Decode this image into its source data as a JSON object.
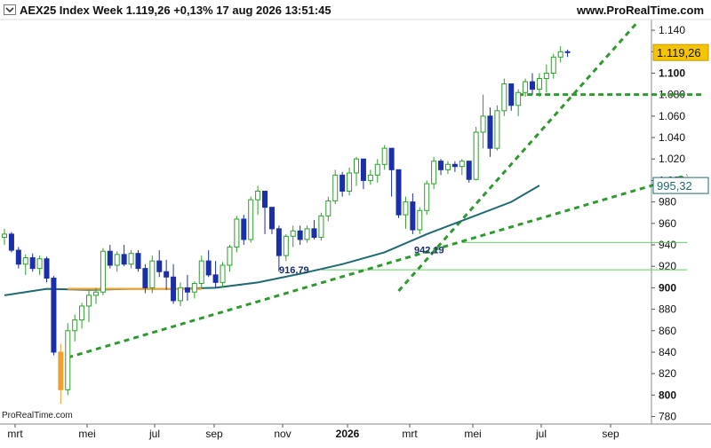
{
  "header": {
    "title": "AEX25 Index Week 1.119,26 +0,13% 17 aug 2026 13:51:45",
    "brand": "www.ProRealTime.com"
  },
  "watermark": "ProRealTime.com",
  "icons": {
    "settings": "chevron-down-icon"
  },
  "colors": {
    "up": "#2e9e2e",
    "down": "#1a2fa8",
    "ma": "#1f6a70",
    "trend": "#2e9a2e",
    "price_badge": "#f5c400",
    "ma_badge_border": "#1f6a70",
    "highlight": "#f0a030"
  },
  "chart_data": {
    "type": "candlestick",
    "title": "AEX25 Index Week",
    "x_labels": [
      "mrt",
      "mei",
      "jul",
      "sep",
      "nov",
      "2026",
      "mrt",
      "mei",
      "jul",
      "sep"
    ],
    "y_ticks": [
      "780",
      "800",
      "820",
      "840",
      "860",
      "880",
      "900",
      "920",
      "940",
      "960",
      "980",
      "1.000",
      "1.020",
      "1.040",
      "1.060",
      "1.080",
      "1.100",
      "1.120",
      "1.140"
    ],
    "y_tick_values": [
      780,
      800,
      820,
      840,
      860,
      880,
      900,
      920,
      940,
      960,
      980,
      1000,
      1020,
      1040,
      1060,
      1080,
      1100,
      1120,
      1140
    ],
    "bold_ticks": [
      800,
      900,
      1100
    ],
    "ylim": [
      773,
      1150
    ],
    "candles": [
      [
        947,
        955,
        940,
        950
      ],
      [
        950,
        952,
        933,
        935
      ],
      [
        935,
        938,
        918,
        922
      ],
      [
        922,
        931,
        912,
        928
      ],
      [
        928,
        932,
        915,
        918
      ],
      [
        918,
        930,
        912,
        927
      ],
      [
        927,
        929,
        905,
        909
      ],
      [
        909,
        911,
        837,
        840
      ],
      [
        840,
        848,
        792,
        805
      ],
      [
        805,
        867,
        800,
        860
      ],
      [
        860,
        875,
        850,
        870
      ],
      [
        870,
        886,
        862,
        883
      ],
      [
        883,
        897,
        868,
        893
      ],
      [
        893,
        900,
        885,
        896
      ],
      [
        896,
        937,
        893,
        934
      ],
      [
        934,
        940,
        918,
        921
      ],
      [
        921,
        934,
        915,
        931
      ],
      [
        931,
        940,
        920,
        922
      ],
      [
        922,
        935,
        918,
        932
      ],
      [
        932,
        935,
        915,
        918
      ],
      [
        918,
        922,
        895,
        900
      ],
      [
        900,
        930,
        895,
        925
      ],
      [
        925,
        935,
        910,
        915
      ],
      [
        915,
        926,
        898,
        910
      ],
      [
        910,
        922,
        885,
        888
      ],
      [
        888,
        905,
        883,
        900
      ],
      [
        900,
        912,
        888,
        896
      ],
      [
        896,
        906,
        890,
        904
      ],
      [
        904,
        930,
        900,
        925
      ],
      [
        925,
        935,
        910,
        912
      ],
      [
        912,
        925,
        900,
        905
      ],
      [
        905,
        924,
        900,
        921
      ],
      [
        921,
        940,
        915,
        938
      ],
      [
        938,
        967,
        933,
        964
      ],
      [
        964,
        968,
        940,
        945
      ],
      [
        945,
        985,
        942,
        982
      ],
      [
        982,
        995,
        968,
        990
      ],
      [
        990,
        978,
        950,
        975
      ],
      [
        975,
        973,
        950,
        955
      ],
      [
        955,
        958,
        915,
        930
      ],
      [
        930,
        950,
        925,
        948
      ],
      [
        948,
        958,
        938,
        953
      ],
      [
        953,
        958,
        940,
        945
      ],
      [
        945,
        958,
        942,
        955
      ],
      [
        955,
        963,
        945,
        947
      ],
      [
        947,
        970,
        944,
        967
      ],
      [
        967,
        985,
        962,
        981
      ],
      [
        981,
        1010,
        978,
        1005
      ],
      [
        1005,
        1008,
        985,
        990
      ],
      [
        990,
        1012,
        986,
        1007
      ],
      [
        1007,
        1022,
        995,
        1020
      ],
      [
        1020,
        1003,
        992,
        1000
      ],
      [
        1000,
        1010,
        996,
        1005
      ],
      [
        1005,
        1020,
        998,
        1015
      ],
      [
        1015,
        1033,
        1010,
        1030
      ],
      [
        1030,
        1030,
        985,
        1010
      ],
      [
        1010,
        1000,
        965,
        968
      ],
      [
        968,
        985,
        955,
        980
      ],
      [
        980,
        988,
        950,
        954
      ],
      [
        954,
        975,
        950,
        972
      ],
      [
        972,
        1000,
        968,
        997
      ],
      [
        997,
        1022,
        992,
        1018
      ],
      [
        1018,
        1020,
        1005,
        1010
      ],
      [
        1010,
        1018,
        1006,
        1015
      ],
      [
        1015,
        1018,
        1008,
        1013
      ],
      [
        1013,
        1020,
        1005,
        1018
      ],
      [
        1018,
        1010,
        998,
        1001
      ],
      [
        1001,
        1050,
        1000,
        1045
      ],
      [
        1045,
        1080,
        1030,
        1060
      ],
      [
        1060,
        1068,
        1022,
        1030
      ],
      [
        1030,
        1070,
        1028,
        1065
      ],
      [
        1065,
        1095,
        1060,
        1090
      ],
      [
        1090,
        1088,
        1065,
        1070
      ],
      [
        1070,
        1085,
        1060,
        1082
      ],
      [
        1082,
        1095,
        1078,
        1092
      ],
      [
        1092,
        1100,
        1080,
        1085
      ],
      [
        1085,
        1100,
        1078,
        1095
      ],
      [
        1095,
        1108,
        1082,
        1100
      ],
      [
        1100,
        1118,
        1095,
        1115
      ],
      [
        1115,
        1125,
        1110,
        1120
      ],
      [
        1120,
        1122,
        1115,
        1119.26
      ]
    ],
    "highlight_candle_index": 8,
    "ma": {
      "name": "MA",
      "points": [
        [
          0,
          893
        ],
        [
          6,
          899
        ],
        [
          12,
          898
        ],
        [
          18,
          899
        ],
        [
          24,
          899
        ],
        [
          30,
          900
        ],
        [
          36,
          905
        ],
        [
          42,
          913
        ],
        [
          48,
          922
        ],
        [
          54,
          933
        ],
        [
          60,
          950
        ],
        [
          66,
          965
        ],
        [
          72,
          980
        ],
        [
          76,
          995.32
        ]
      ]
    },
    "hlines": [
      {
        "value": 942.19,
        "from": 65,
        "to": 97,
        "color": "#66cc66",
        "label": "942,19"
      },
      {
        "value": 916.79,
        "from": 45,
        "to": 97,
        "color": "#66cc66",
        "label": "916,79"
      },
      {
        "value": 1080,
        "from": 73,
        "to": 99,
        "color": "#2e9a2e",
        "dashed": true
      }
    ],
    "trendlines": [
      {
        "p1": [
          9,
          835
        ],
        "p2": [
          97,
          1005
        ]
      },
      {
        "p1": [
          56,
          897
        ],
        "p2": [
          90,
          1148
        ]
      }
    ],
    "price_label": "1.119,26",
    "price_value": 1119.26,
    "ma_label": "995,32",
    "ma_value": 995.32,
    "label_916": "916,79",
    "label_942": "942,19"
  }
}
